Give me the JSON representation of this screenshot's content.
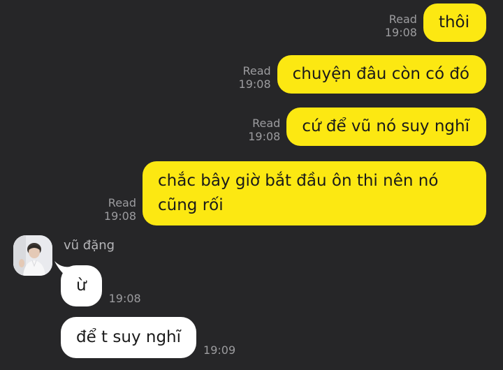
{
  "colors": {
    "background": "#262628",
    "outgoing_bubble": "#fce812",
    "incoming_bubble": "#ffffff",
    "meta_text": "#9c9c9f"
  },
  "outgoing": [
    {
      "text": "thôi",
      "read": "Read",
      "time": "19:08"
    },
    {
      "text": "chuyện đâu còn có đó",
      "read": "Read",
      "time": "19:08"
    },
    {
      "text": "cứ để vũ nó suy nghĩ",
      "read": "Read",
      "time": "19:08"
    },
    {
      "text": "chắc bây giờ bắt đầu ôn thi nên nó cũng rối",
      "read": "Read",
      "time": "19:08"
    }
  ],
  "incoming": {
    "sender": "vũ đặng",
    "avatar_icon": "profile-photo",
    "messages": [
      {
        "text": "ừ",
        "time": "19:08"
      },
      {
        "text": "để t suy nghĩ",
        "time": "19:09"
      }
    ]
  }
}
